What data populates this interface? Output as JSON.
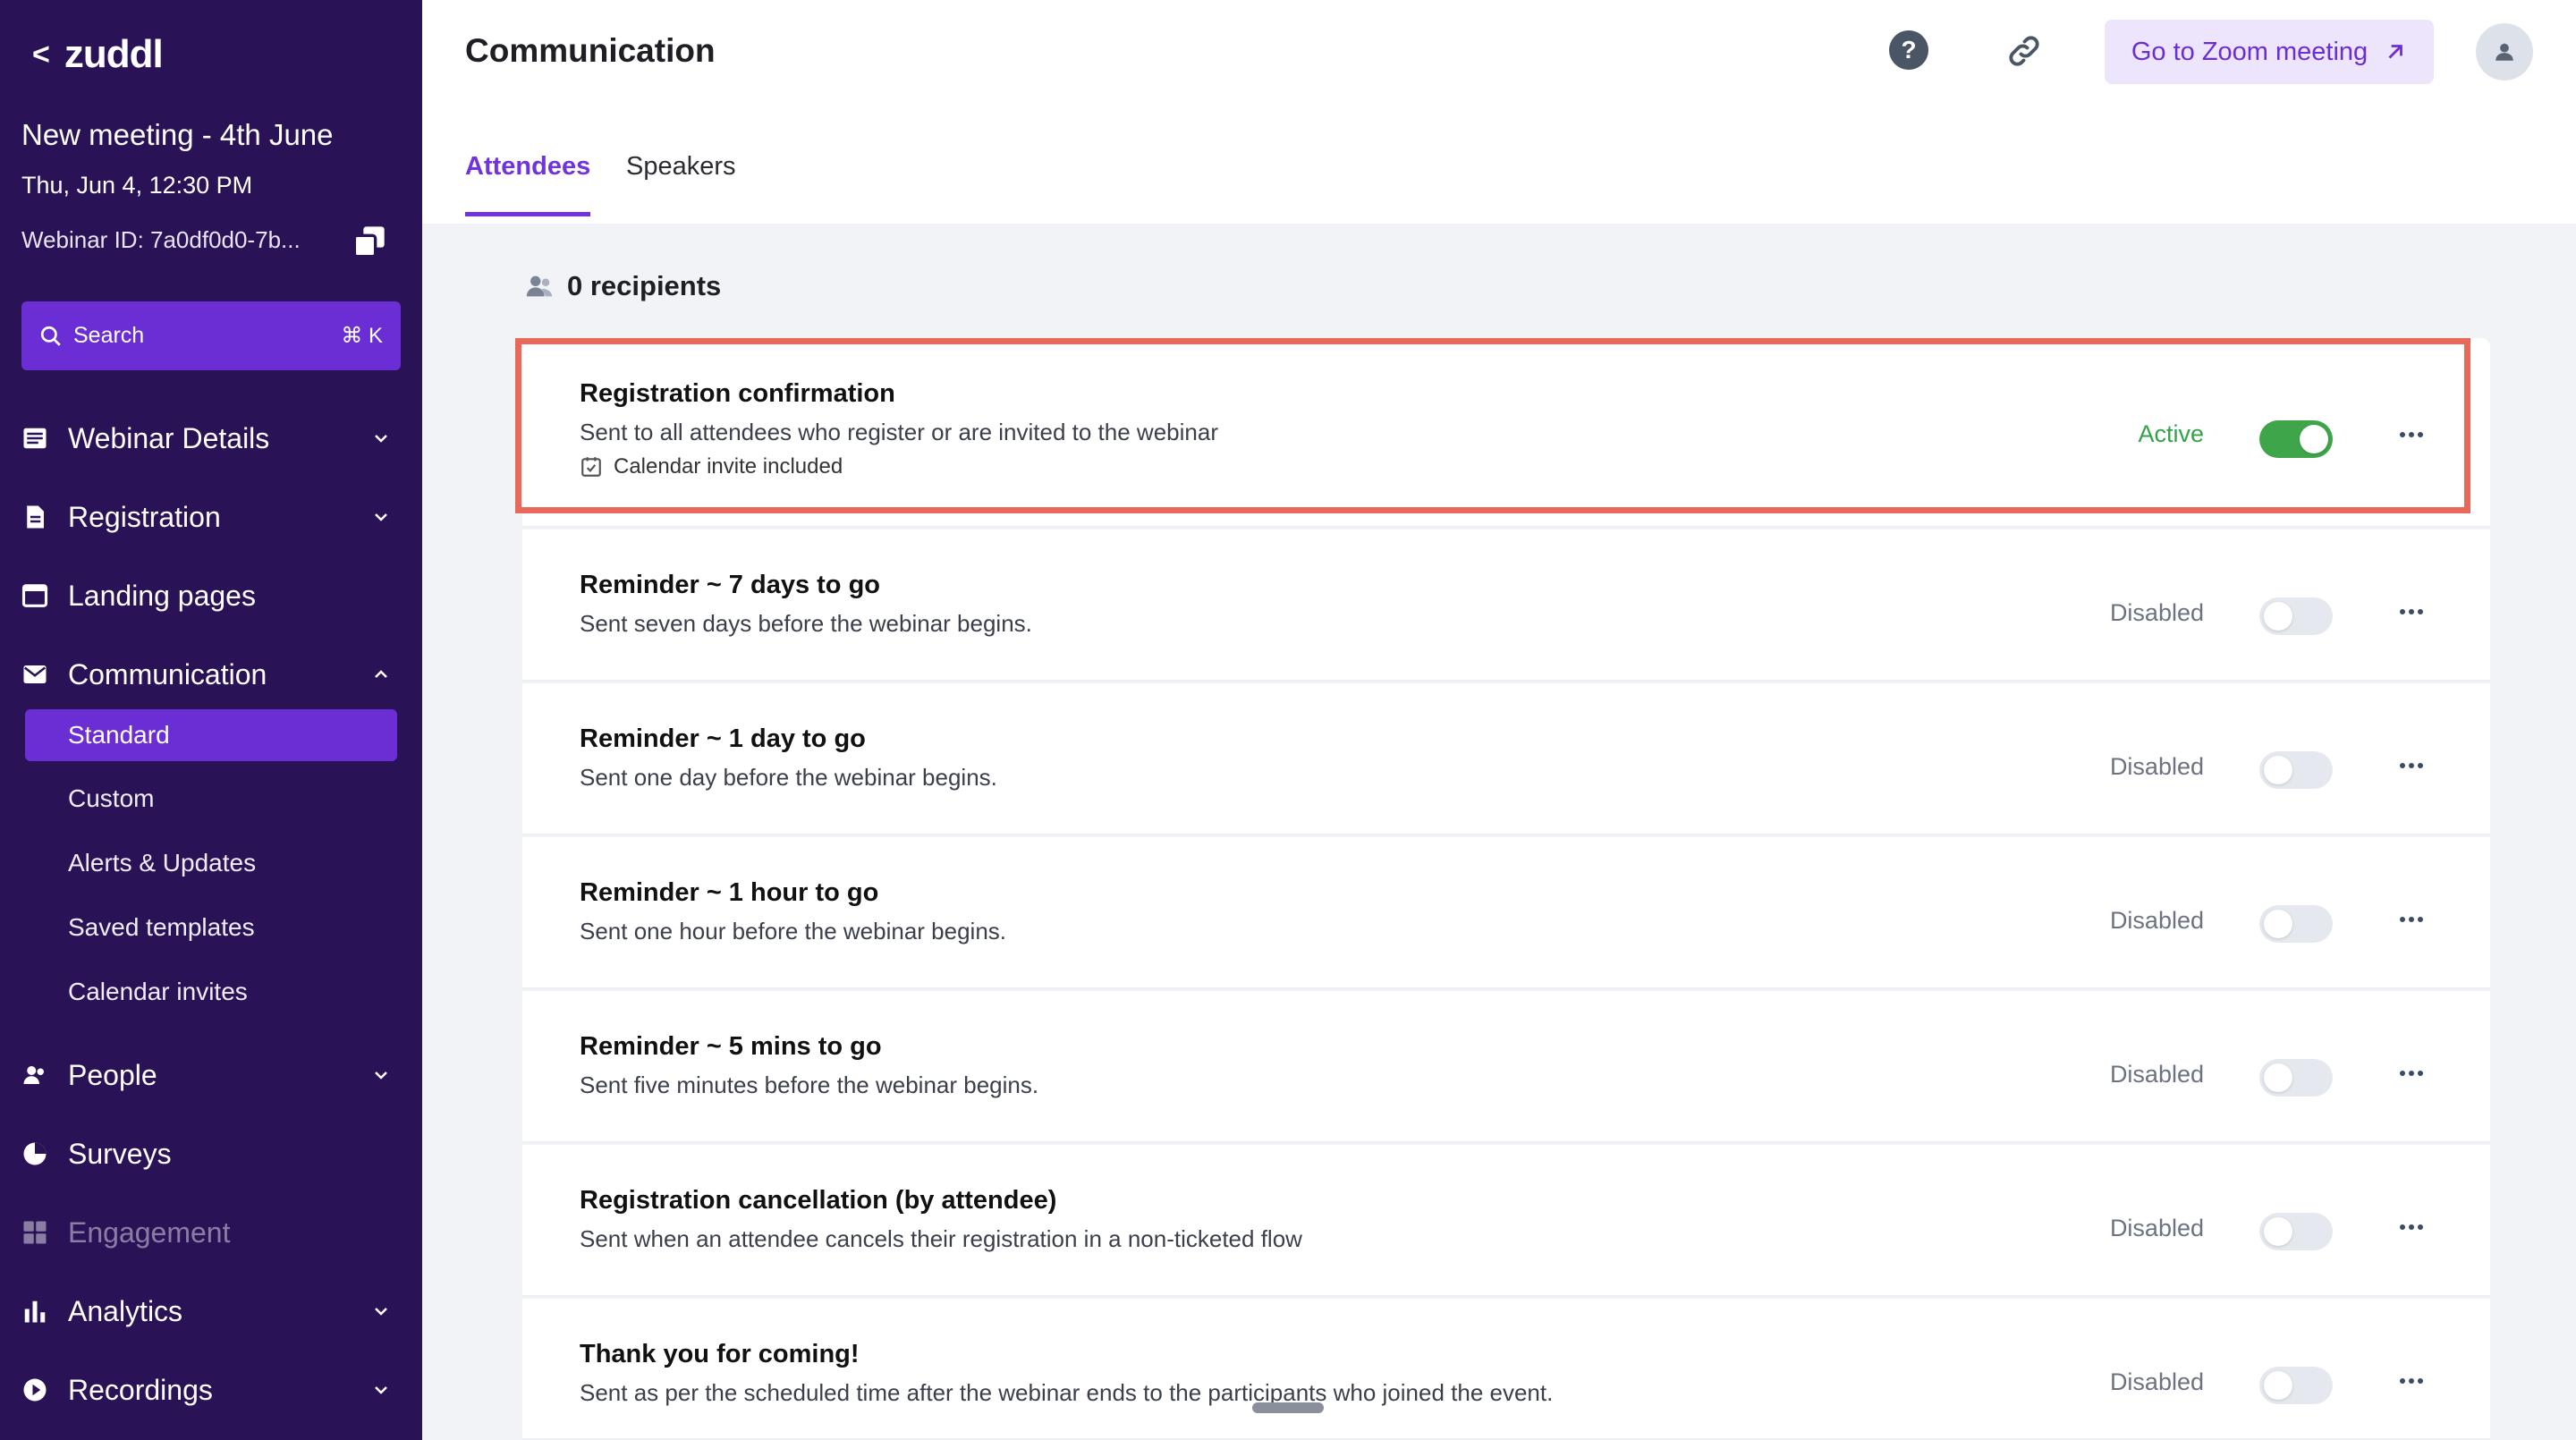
{
  "sidebar": {
    "brand": "zuddl",
    "meeting_title": "New meeting - 4th June",
    "meeting_date": "Thu, Jun 4, 12:30 PM",
    "webinar_id": "Webinar ID: 7a0df0d0-7b...",
    "search": {
      "label": "Search",
      "shortcut": "⌘ K"
    },
    "nav": [
      {
        "label": "Webinar Details",
        "icon": "list-icon",
        "expandable": true
      },
      {
        "label": "Registration",
        "icon": "document-icon",
        "expandable": true
      },
      {
        "label": "Landing pages",
        "icon": "browser-icon",
        "expandable": false
      },
      {
        "label": "Communication",
        "icon": "mail-icon",
        "expandable": true,
        "expanded": true
      },
      {
        "label": "People",
        "icon": "people-icon",
        "expandable": true
      },
      {
        "label": "Surveys",
        "icon": "pie-icon",
        "expandable": false
      },
      {
        "label": "Engagement",
        "icon": "grid-icon",
        "expandable": false,
        "disabled": true
      },
      {
        "label": "Analytics",
        "icon": "bar-chart-icon",
        "expandable": true
      },
      {
        "label": "Recordings",
        "icon": "play-icon",
        "expandable": true
      }
    ],
    "communication_sub": [
      {
        "label": "Standard",
        "active": true
      },
      {
        "label": "Custom"
      },
      {
        "label": "Alerts & Updates"
      },
      {
        "label": "Saved templates"
      },
      {
        "label": "Calendar invites"
      }
    ]
  },
  "header": {
    "title": "Communication",
    "zoom_button": "Go to Zoom meeting"
  },
  "tabs": [
    {
      "label": "Attendees",
      "active": true
    },
    {
      "label": "Speakers"
    }
  ],
  "recipients": "0 recipients",
  "communications": [
    {
      "title": "Registration confirmation",
      "desc": "Sent to all attendees who register or are invited to the webinar",
      "extra": "Calendar invite included",
      "status": "Active",
      "enabled": true
    },
    {
      "title": "Reminder ~ 7 days to go",
      "desc": "Sent seven days before the webinar begins.",
      "status": "Disabled",
      "enabled": false
    },
    {
      "title": "Reminder ~ 1 day to go",
      "desc": "Sent one day before the webinar begins.",
      "status": "Disabled",
      "enabled": false
    },
    {
      "title": "Reminder ~ 1 hour to go",
      "desc": "Sent one hour before the webinar begins.",
      "status": "Disabled",
      "enabled": false
    },
    {
      "title": "Reminder ~ 5 mins to go",
      "desc": "Sent five minutes before the webinar begins.",
      "status": "Disabled",
      "enabled": false
    },
    {
      "title": "Registration cancellation (by attendee)",
      "desc": "Sent when an attendee cancels their registration in a non-ticketed flow",
      "status": "Disabled",
      "enabled": false
    },
    {
      "title": "Thank you for coming!",
      "desc": "Sent as per the scheduled time after the webinar ends to the participants who joined the event.",
      "status": "Disabled",
      "enabled": false
    }
  ],
  "colors": {
    "sidebar_bg": "#2a1257",
    "accent": "#6a2ed4",
    "active_green": "#3ea54b",
    "highlight": "#e8695a"
  }
}
